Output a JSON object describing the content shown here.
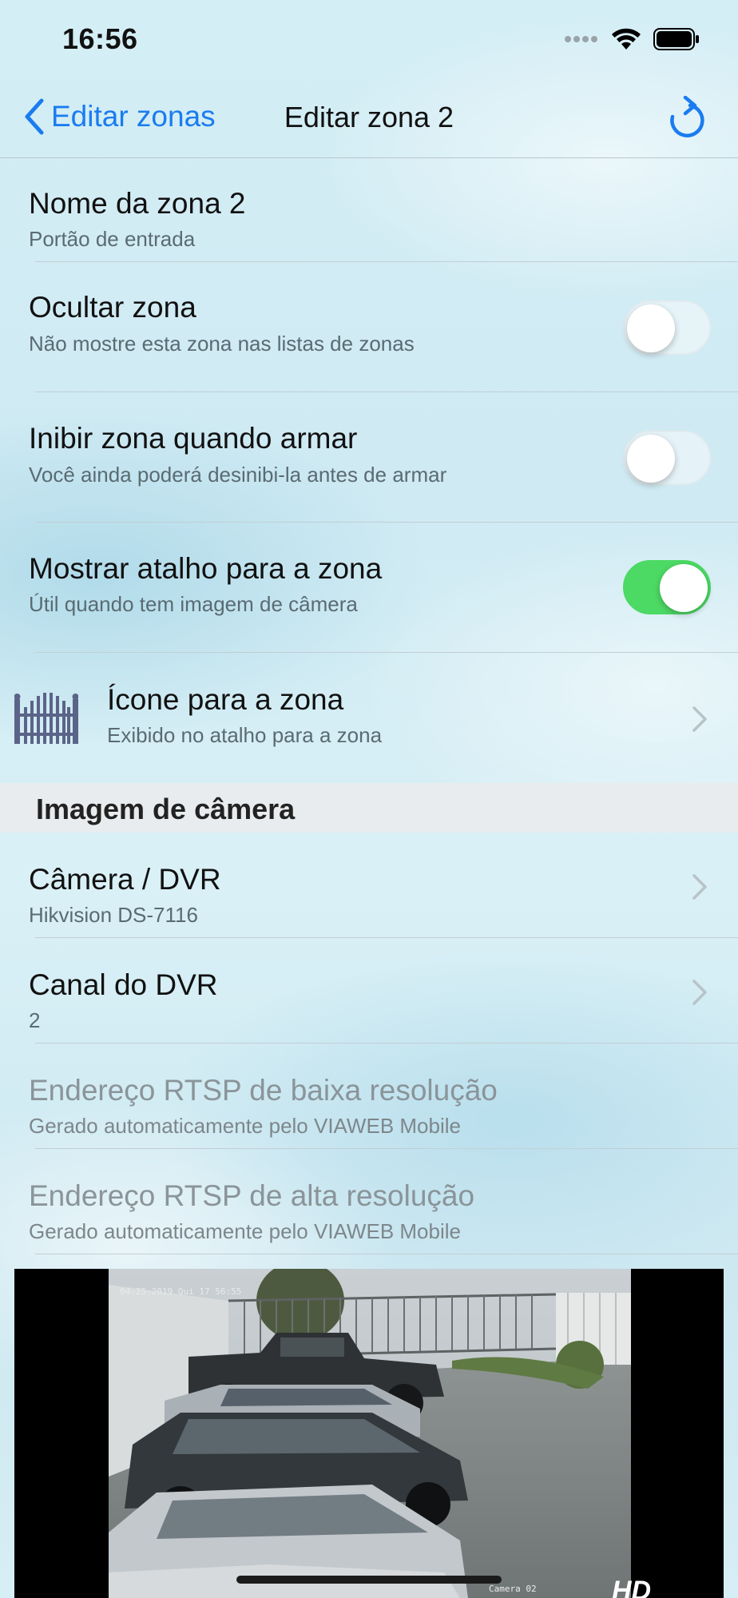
{
  "status_bar": {
    "time": "16:56"
  },
  "nav": {
    "back_label": "Editar zonas",
    "title": "Editar zona 2"
  },
  "rows": {
    "name": {
      "title": "Nome da zona 2",
      "subtitle": "Portão de entrada"
    },
    "hide": {
      "title": "Ocultar zona",
      "subtitle": "Não mostre esta zona nas listas de zonas",
      "on": false
    },
    "inhibit": {
      "title": "Inibir zona quando armar",
      "subtitle": "Você ainda poderá desinibi-la antes de armar",
      "on": false
    },
    "shortcut": {
      "title": "Mostrar atalho para a zona",
      "subtitle": "Útil quando tem imagem de câmera",
      "on": true
    },
    "icon": {
      "title": "Ícone para a zona",
      "subtitle": "Exibido no atalho para a zona"
    }
  },
  "camera_section": {
    "header": "Imagem de câmera",
    "camera": {
      "title": "Câmera / DVR",
      "subtitle": "Hikvision DS-7116"
    },
    "channel": {
      "title": "Canal do DVR",
      "subtitle": "2"
    },
    "rtsp_low": {
      "title": "Endereço RTSP de baixa resolução",
      "subtitle": "Gerado automaticamente pelo VIAWEB Mobile"
    },
    "rtsp_high": {
      "title": "Endereço RTSP de alta resolução",
      "subtitle": "Gerado automaticamente pelo VIAWEB Mobile"
    }
  },
  "camera_feed": {
    "timestamp": "04-25-2019 Qui 17 56:55",
    "label": "Camera 02",
    "badge": "HD"
  },
  "colors": {
    "accent": "#1a7cf0",
    "toggle_on": "#4cd964"
  }
}
